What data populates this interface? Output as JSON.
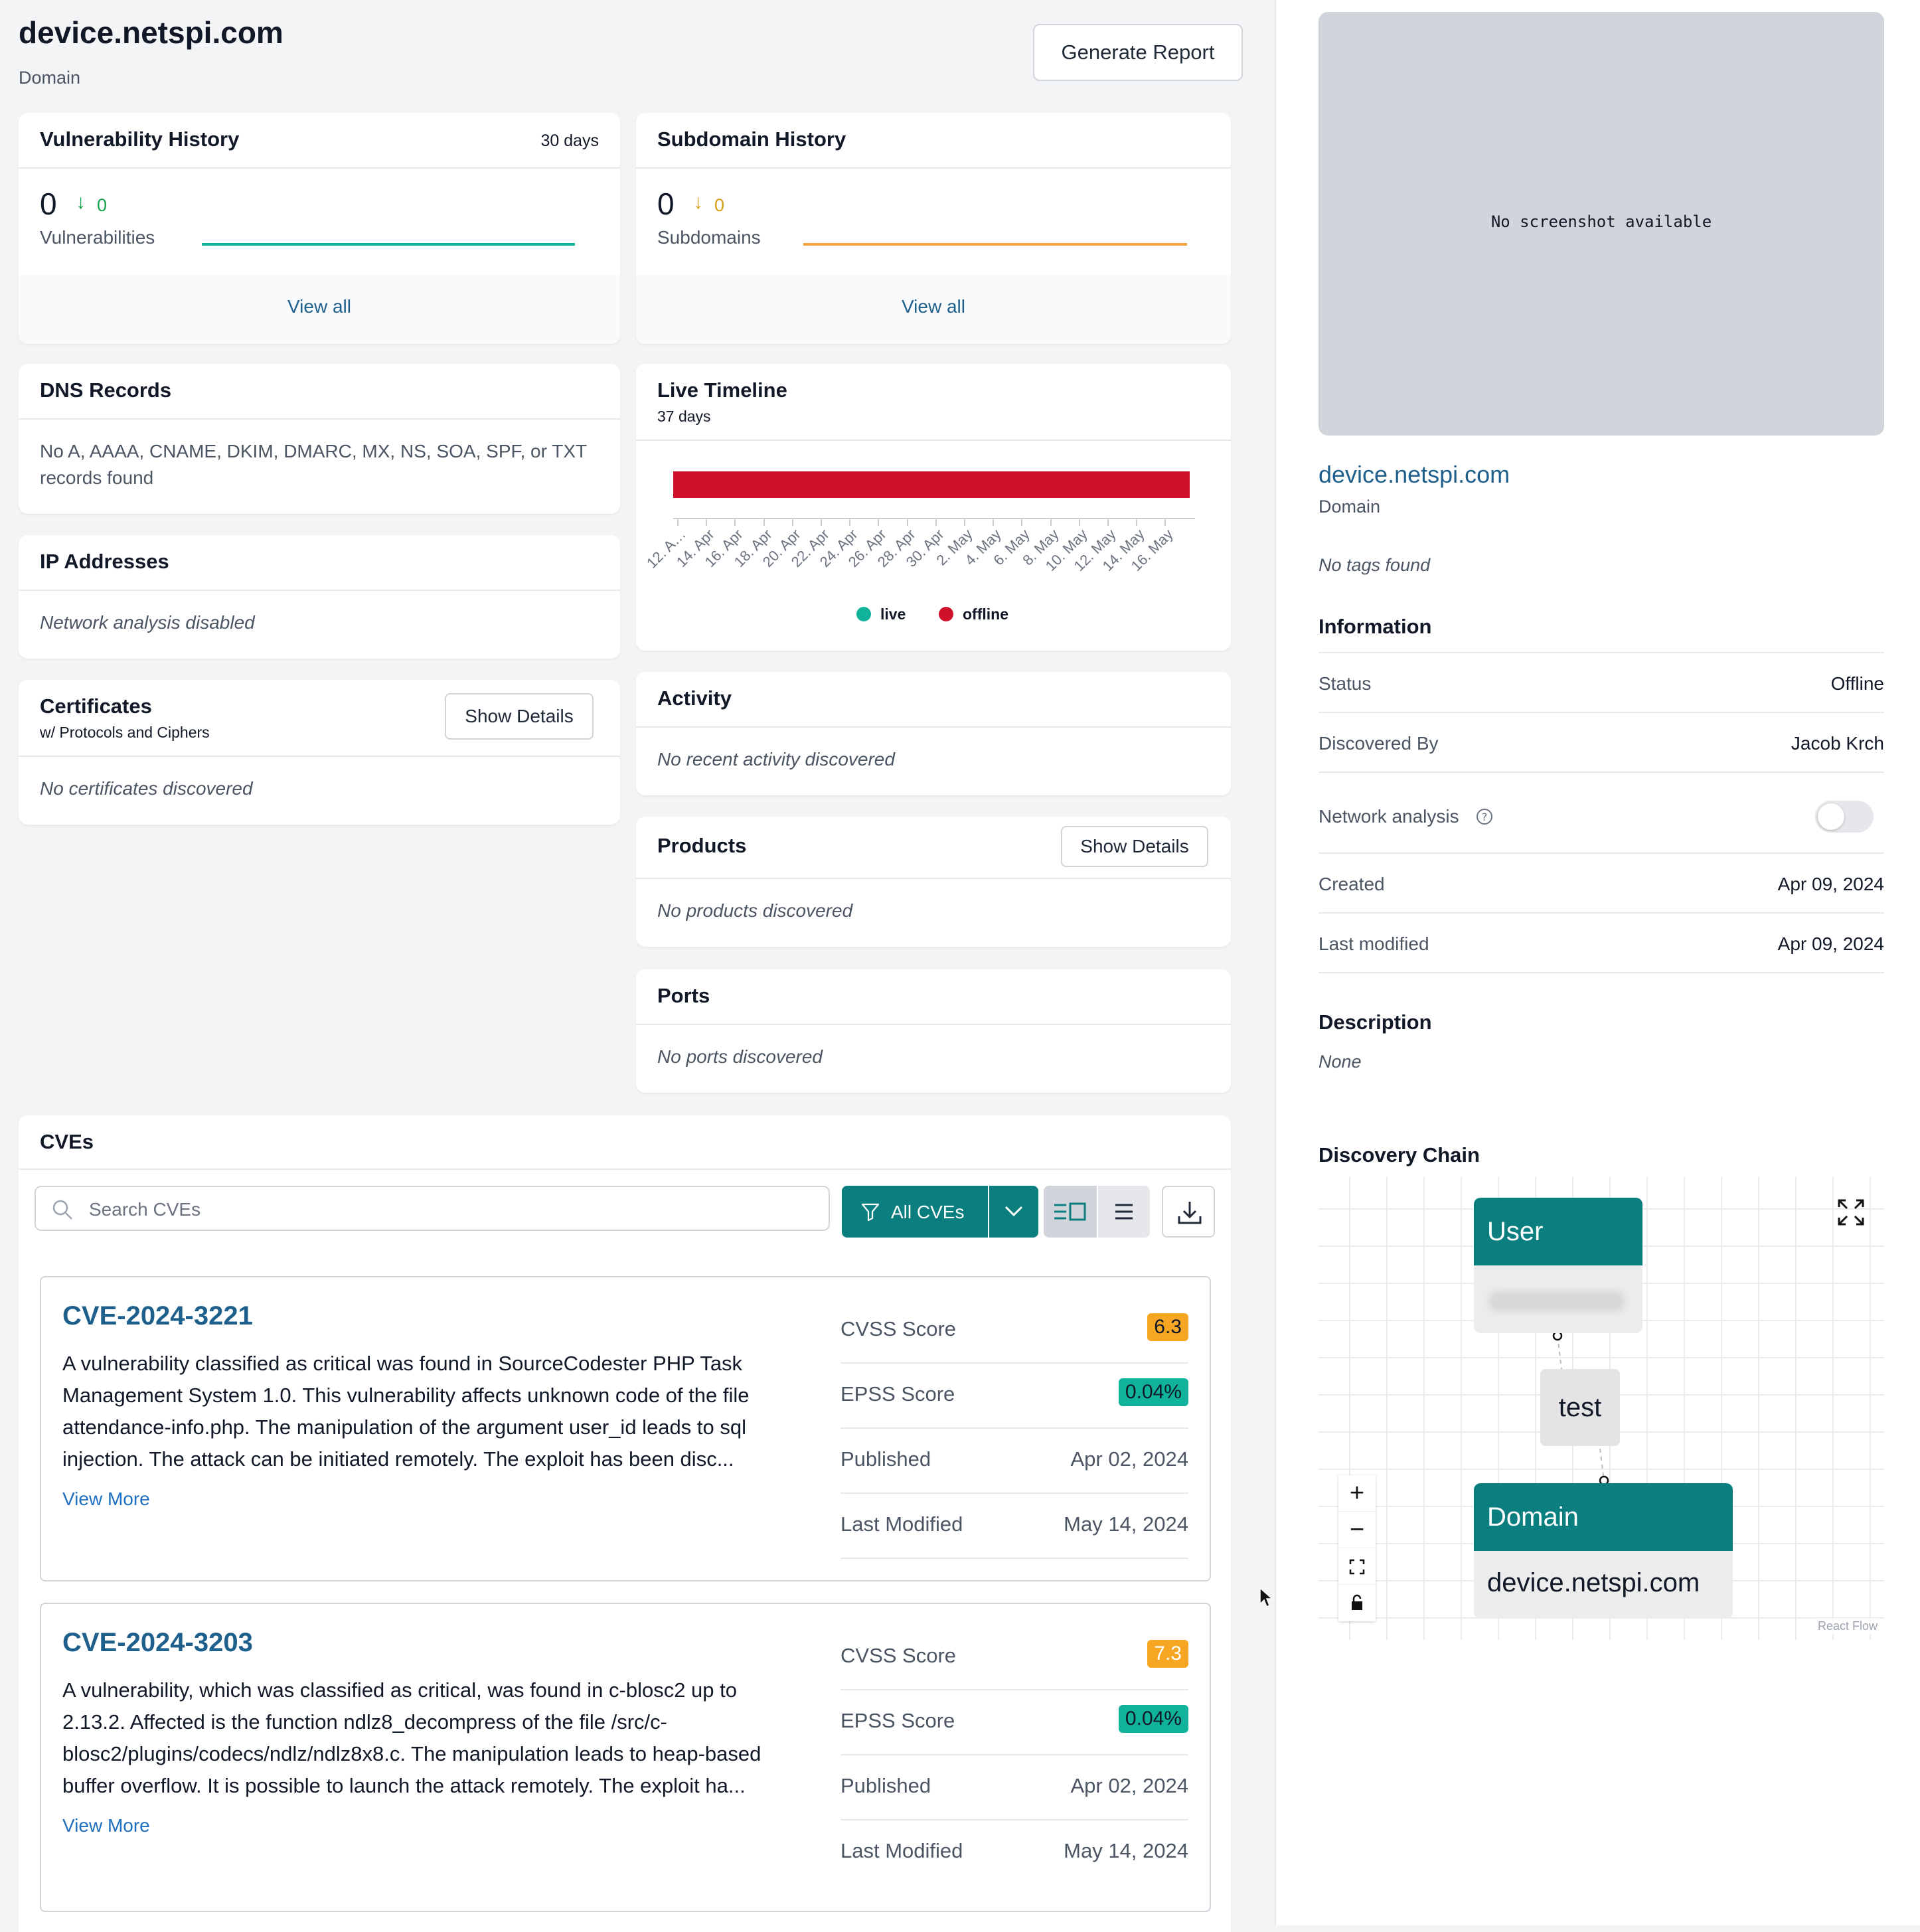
{
  "header": {
    "title": "device.netspi.com",
    "subtitle": "Domain",
    "generate_report": "Generate Report"
  },
  "vuln_history": {
    "title": "Vulnerability History",
    "range": "30 days",
    "count": "0",
    "delta": "0",
    "label": "Vulnerabilities",
    "view_all": "View all"
  },
  "subdomain_history": {
    "title": "Subdomain History",
    "count": "0",
    "delta": "0",
    "label": "Subdomains",
    "view_all": "View all"
  },
  "dns": {
    "title": "DNS Records",
    "text": "No A, AAAA, CNAME, DKIM, DMARC, MX, NS, SOA, SPF, or TXT records found"
  },
  "ip": {
    "title": "IP Addresses",
    "text": "Network analysis disabled"
  },
  "certificates": {
    "title": "Certificates",
    "subtitle": "w/ Protocols and Ciphers",
    "button": "Show Details",
    "text": "No certificates discovered"
  },
  "live_timeline": {
    "title": "Live Timeline",
    "subtitle": "37 days",
    "ticks": [
      "12. A…",
      "14. Apr",
      "16. Apr",
      "18. Apr",
      "20. Apr",
      "22. Apr",
      "24. Apr",
      "26. Apr",
      "28. Apr",
      "30. Apr",
      "2. May",
      "4. May",
      "6. May",
      "8. May",
      "10. May",
      "12. May",
      "14. May",
      "16. May"
    ],
    "legend_live": "live",
    "legend_offline": "offline",
    "colors": {
      "live": "#10b39a",
      "offline": "#d0112b"
    }
  },
  "activity": {
    "title": "Activity",
    "text": "No recent activity discovered"
  },
  "products": {
    "title": "Products",
    "button": "Show Details",
    "text": "No products discovered"
  },
  "ports": {
    "title": "Ports",
    "text": "No ports discovered"
  },
  "cves": {
    "title": "CVEs",
    "search_placeholder": "Search CVEs",
    "filter_label": "All CVEs",
    "items": [
      {
        "id": "CVE-2024-3221",
        "desc_lines": [
          "A vulnerability classified as critical was found in SourceCodester PHP Task",
          "Management System 1.0. This vulnerability affects unknown code of the file",
          "attendance-info.php. The manipulation of the argument user_id leads to sql",
          "injection. The attack can be initiated remotely. The exploit has been disc..."
        ],
        "view_more": "View More",
        "cvss_label": "CVSS Score",
        "cvss": "6.3",
        "cvss_color": "#f6a623",
        "epss_label": "EPSS Score",
        "epss": "0.04%",
        "published_label": "Published",
        "published": "Apr 02, 2024",
        "modified_label": "Last Modified",
        "modified": "May 14, 2024"
      },
      {
        "id": "CVE-2024-3203",
        "desc_lines": [
          "A vulnerability, which was classified as critical, was found in c-blosc2 up to",
          "2.13.2. Affected is the function ndlz8_decompress of the file /src/c-",
          "blosc2/plugins/codecs/ndlz/ndlz8x8.c. The manipulation leads to heap-based",
          "buffer overflow. It is possible to launch the attack remotely. The exploit ha..."
        ],
        "view_more": "View More",
        "cvss_label": "CVSS Score",
        "cvss": "7.3",
        "cvss_color": "#f6a623",
        "epss_label": "EPSS Score",
        "epss": "0.04%",
        "published_label": "Published",
        "published": "Apr 02, 2024",
        "modified_label": "Last Modified",
        "modified": "May 14, 2024"
      }
    ]
  },
  "side": {
    "screenshot_text": "No screenshot available",
    "domain_link": "device.netspi.com",
    "domain_type": "Domain",
    "tags_text": "No tags found",
    "info_title": "Information",
    "status_label": "Status",
    "status_value": "Offline",
    "discovered_label": "Discovered By",
    "discovered_value": "Jacob Krch",
    "network_label": "Network analysis",
    "created_label": "Created",
    "created_value": "Apr 09, 2024",
    "modified_label": "Last modified",
    "modified_value": "Apr 09, 2024",
    "desc_title": "Description",
    "desc_value": "None",
    "chain_title": "Discovery Chain",
    "node_user": "User",
    "node_test": "test",
    "node_domain": "Domain",
    "node_domain_value": "device.netspi.com",
    "watermark": "React Flow"
  },
  "accent": "#0b7f7f"
}
